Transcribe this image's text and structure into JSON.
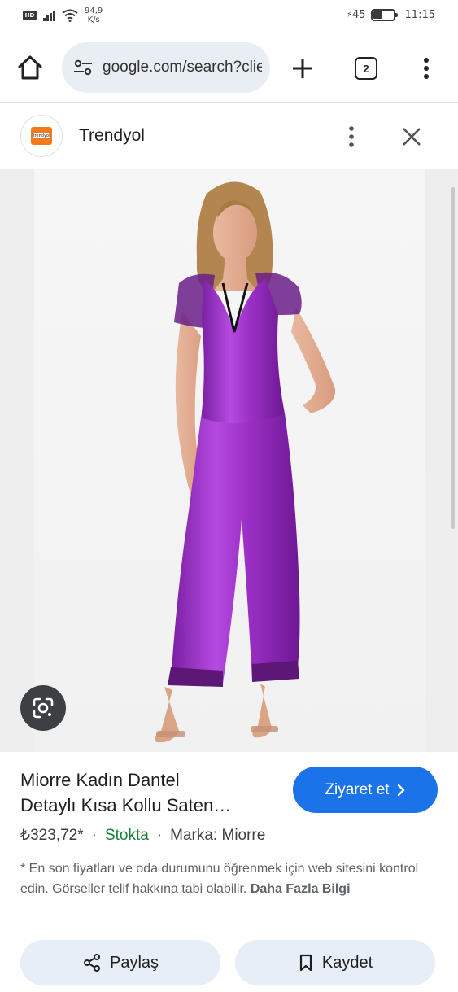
{
  "status_bar": {
    "hd_label": "HD",
    "net_speed_value": "94,9",
    "net_speed_unit": "K/s",
    "battery_level_text": "45",
    "battery_level": 0.45,
    "time": "11:15"
  },
  "browser": {
    "url": "google.com/search?clie",
    "tab_count": "2"
  },
  "source": {
    "logo_text": "trendyol",
    "name": "Trendyol"
  },
  "product": {
    "title_line1": "Miorre Kadın Dantel",
    "title_line2": "Detaylı Kısa Kollu Saten…",
    "visit_label": "Ziyaret et",
    "price": "₺323,72*",
    "separator": "·",
    "stock": "Stokta",
    "brand": "Marka: Miorre",
    "disclaimer": "* En son fiyatları ve oda durumunu öğrenmek için web sitesini kontrol edin. Görseller telif hakkına tabi olabilir.",
    "more_info": "Daha Fazla Bilgi"
  },
  "actions": {
    "share_label": "Paylaş",
    "save_label": "Kaydet"
  },
  "icons": {
    "home": "home-icon",
    "tune": "site-settings-icon",
    "add": "plus-icon",
    "menu": "more-vert-icon",
    "close": "close-icon",
    "lens": "google-lens-icon",
    "share": "share-icon",
    "bookmark": "bookmark-icon",
    "chevron": "chevron-right-icon"
  },
  "colors": {
    "accent": "#1a73e8",
    "stock_green": "#188038",
    "url_pill": "#e9edf4",
    "pill_buttons": "#e8eef7",
    "satin_purple": "#9b2fc4"
  }
}
